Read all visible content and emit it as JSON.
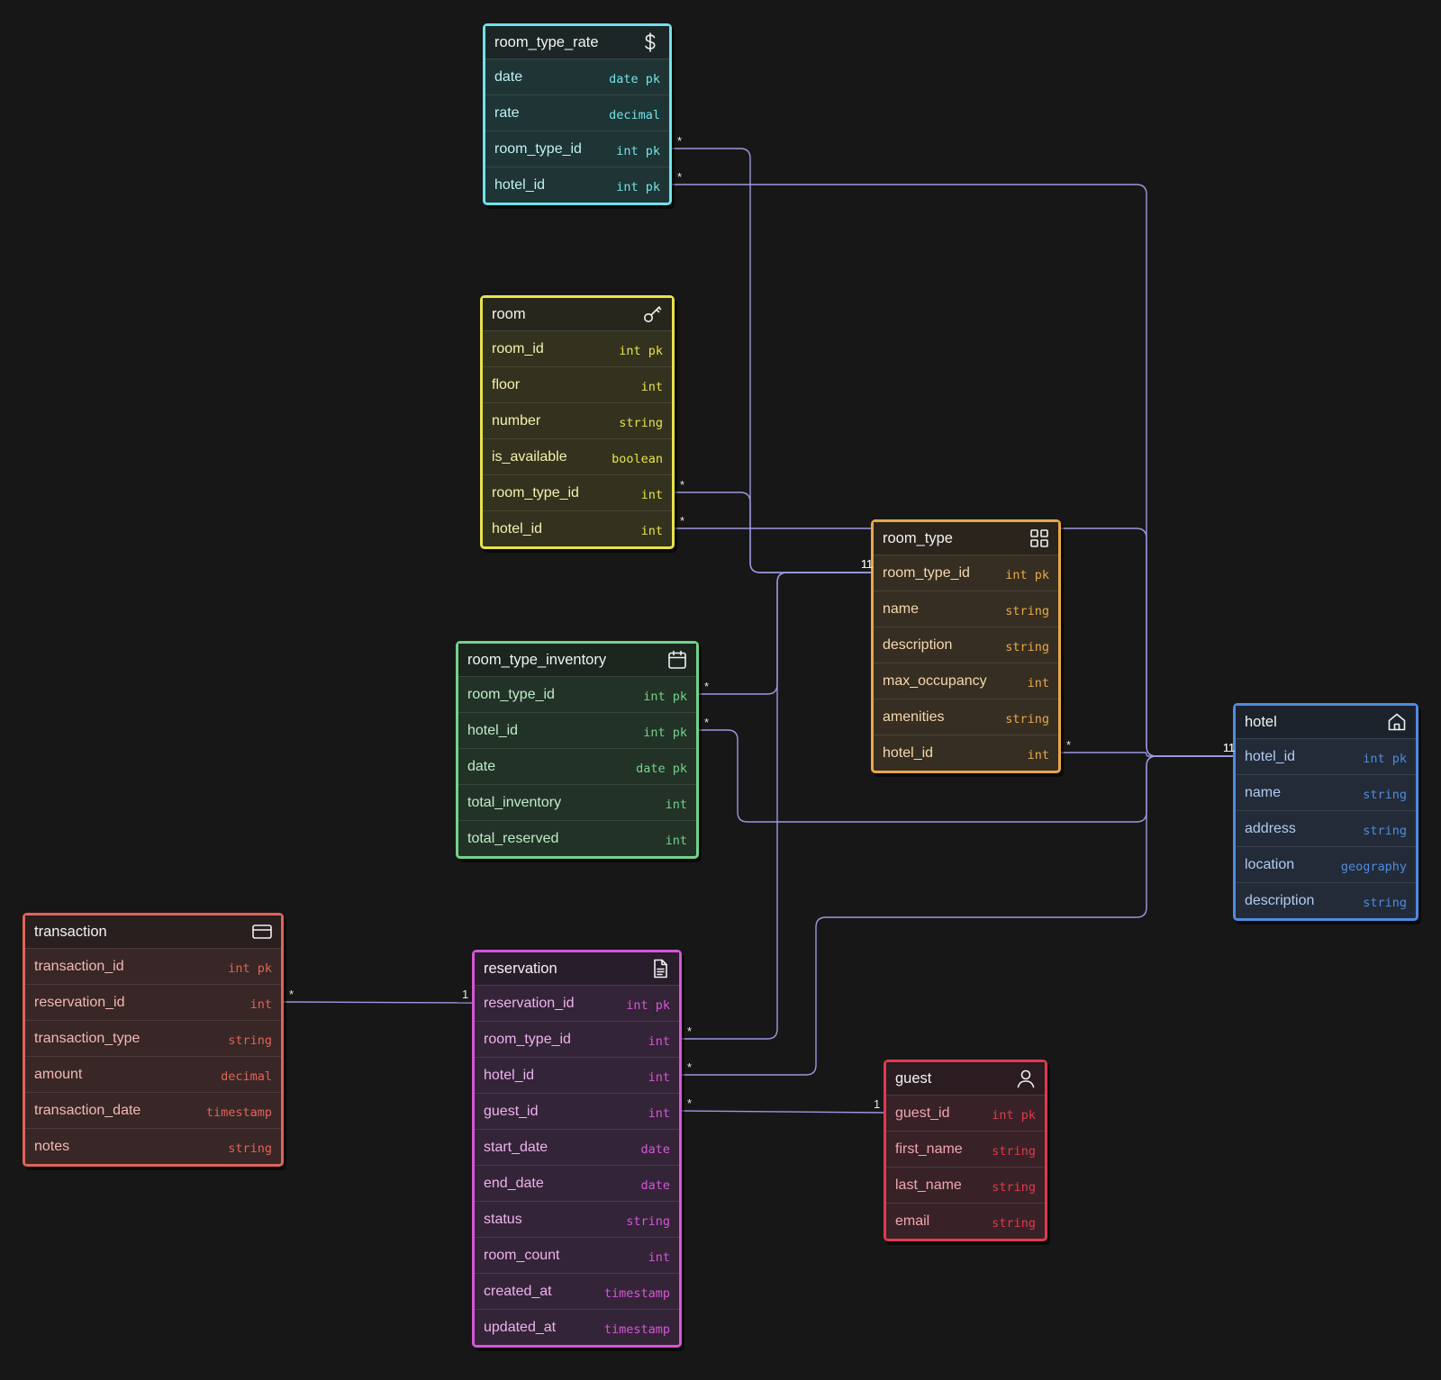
{
  "tables": [
    {
      "key": "room_type_rate",
      "name": "room_type_rate",
      "icon": "dollar-icon",
      "color": "#6fe3e8",
      "bg": "#1f3434",
      "head": "#1c2626",
      "fields": [
        {
          "name": "date",
          "type": "date pk"
        },
        {
          "name": "rate",
          "type": "decimal"
        },
        {
          "name": "room_type_id",
          "type": "int pk"
        },
        {
          "name": "hotel_id",
          "type": "int pk"
        }
      ]
    },
    {
      "key": "room",
      "name": "room",
      "icon": "key-icon",
      "color": "#e8e24a",
      "bg": "#33321f",
      "head": "#26261c",
      "fields": [
        {
          "name": "room_id",
          "type": "int pk"
        },
        {
          "name": "floor",
          "type": "int"
        },
        {
          "name": "number",
          "type": "string"
        },
        {
          "name": "is_available",
          "type": "boolean"
        },
        {
          "name": "room_type_id",
          "type": "int"
        },
        {
          "name": "hotel_id",
          "type": "int"
        }
      ]
    },
    {
      "key": "room_type",
      "name": "room_type",
      "icon": "grid-icon",
      "color": "#e8a84a",
      "bg": "#362e22",
      "head": "#2a241c",
      "fields": [
        {
          "name": "room_type_id",
          "type": "int pk"
        },
        {
          "name": "name",
          "type": "string"
        },
        {
          "name": "description",
          "type": "string"
        },
        {
          "name": "max_occupancy",
          "type": "int"
        },
        {
          "name": "amenities",
          "type": "string"
        },
        {
          "name": "hotel_id",
          "type": "int"
        }
      ]
    },
    {
      "key": "room_type_inventory",
      "name": "room_type_inventory",
      "icon": "calendar-icon",
      "color": "#72d38a",
      "bg": "#233227",
      "head": "#1c261f",
      "fields": [
        {
          "name": "room_type_id",
          "type": "int pk"
        },
        {
          "name": "hotel_id",
          "type": "int pk"
        },
        {
          "name": "date",
          "type": "date pk"
        },
        {
          "name": "total_inventory",
          "type": "int"
        },
        {
          "name": "total_reserved",
          "type": "int"
        }
      ]
    },
    {
      "key": "hotel",
      "name": "hotel",
      "icon": "house-icon",
      "color": "#4f8be0",
      "bg": "#232b38",
      "head": "#1c222c",
      "fields": [
        {
          "name": "hotel_id",
          "type": "int pk"
        },
        {
          "name": "name",
          "type": "string"
        },
        {
          "name": "address",
          "type": "string"
        },
        {
          "name": "location",
          "type": "geography"
        },
        {
          "name": "description",
          "type": "string"
        }
      ]
    },
    {
      "key": "transaction",
      "name": "transaction",
      "icon": "card-icon",
      "color": "#e0645a",
      "bg": "#382726",
      "head": "#2a1f1f",
      "fields": [
        {
          "name": "transaction_id",
          "type": "int pk"
        },
        {
          "name": "reservation_id",
          "type": "int"
        },
        {
          "name": "transaction_type",
          "type": "string"
        },
        {
          "name": "amount",
          "type": "decimal"
        },
        {
          "name": "transaction_date",
          "type": "timestamp"
        },
        {
          "name": "notes",
          "type": "string"
        }
      ]
    },
    {
      "key": "reservation",
      "name": "reservation",
      "icon": "document-icon",
      "color": "#d656d6",
      "bg": "#342438",
      "head": "#281d2b",
      "fields": [
        {
          "name": "reservation_id",
          "type": "int pk"
        },
        {
          "name": "room_type_id",
          "type": "int"
        },
        {
          "name": "hotel_id",
          "type": "int"
        },
        {
          "name": "guest_id",
          "type": "int"
        },
        {
          "name": "start_date",
          "type": "date"
        },
        {
          "name": "end_date",
          "type": "date"
        },
        {
          "name": "status",
          "type": "string"
        },
        {
          "name": "room_count",
          "type": "int"
        },
        {
          "name": "created_at",
          "type": "timestamp"
        },
        {
          "name": "updated_at",
          "type": "timestamp"
        }
      ]
    },
    {
      "key": "guest",
      "name": "guest",
      "icon": "user-icon",
      "color": "#e03a4e",
      "bg": "#382227",
      "head": "#2a1c20",
      "fields": [
        {
          "name": "guest_id",
          "type": "int pk"
        },
        {
          "name": "first_name",
          "type": "string"
        },
        {
          "name": "last_name",
          "type": "string"
        },
        {
          "name": "email",
          "type": "string"
        }
      ]
    }
  ],
  "relations": [
    {
      "from": "room_type_rate.room_type_id",
      "to": "room_type.room_type_id",
      "from_card": "*",
      "to_card": "1"
    },
    {
      "from": "room_type_rate.hotel_id",
      "to": "hotel.hotel_id",
      "from_card": "*",
      "to_card": "1"
    },
    {
      "from": "room.room_type_id",
      "to": "room_type.room_type_id",
      "from_card": "*",
      "to_card": "1"
    },
    {
      "from": "room.hotel_id",
      "to": "hotel.hotel_id",
      "from_card": "*",
      "to_card": "1"
    },
    {
      "from": "room_type_inventory.room_type_id",
      "to": "room_type.room_type_id",
      "from_card": "*",
      "to_card": "1"
    },
    {
      "from": "room_type_inventory.hotel_id",
      "to": "hotel.hotel_id",
      "from_card": "*",
      "to_card": "1"
    },
    {
      "from": "room_type.hotel_id",
      "to": "hotel.hotel_id",
      "from_card": "*",
      "to_card": "1"
    },
    {
      "from": "reservation.room_type_id",
      "to": "room_type.room_type_id",
      "from_card": "*",
      "to_card": "1"
    },
    {
      "from": "reservation.hotel_id",
      "to": "hotel.hotel_id",
      "from_card": "*",
      "to_card": "1"
    },
    {
      "from": "reservation.guest_id",
      "to": "guest.guest_id",
      "from_card": "*",
      "to_card": "1"
    },
    {
      "from": "transaction.reservation_id",
      "to": "reservation.reservation_id",
      "from_card": "*",
      "to_card": "1"
    }
  ],
  "connector_color": "#9b99e0"
}
